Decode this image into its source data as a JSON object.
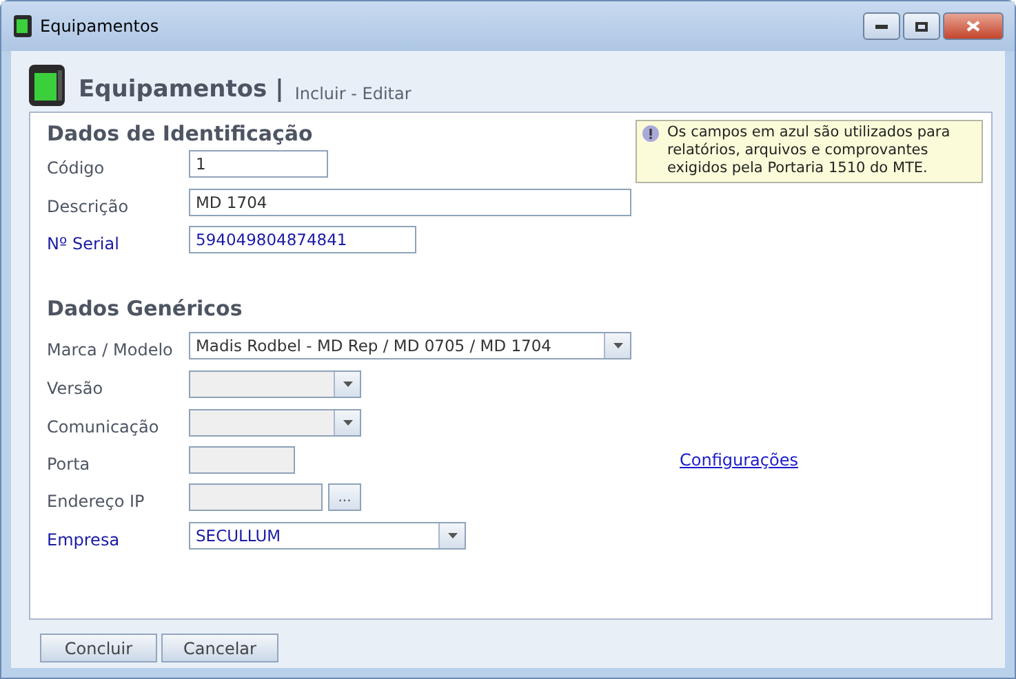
{
  "window": {
    "title": "Equipamentos"
  },
  "header": {
    "title": "Equipamentos",
    "separator": "|",
    "subtitle": "Incluir - Editar"
  },
  "notice": {
    "text": "Os campos em azul são utilizados para relatórios, arquivos e comprovantes exigidos pela Portaria 1510 do MTE."
  },
  "sections": [
    {
      "title": "Dados de Identificação",
      "fields": [
        {
          "label": "Código",
          "kind": "text",
          "value": "1",
          "highlighted": false,
          "disabled": false
        },
        {
          "label": "Descrição",
          "kind": "text",
          "value": "MD 1704",
          "highlighted": false,
          "disabled": false
        },
        {
          "label": "Nº Serial",
          "kind": "text",
          "value": "594049804874841",
          "highlighted": true,
          "disabled": false
        }
      ]
    },
    {
      "title": "Dados Genéricos",
      "fields": [
        {
          "label": "Marca / Modelo",
          "kind": "select",
          "value": "Madis Rodbel - MD Rep / MD 0705 / MD 1704",
          "highlighted": false,
          "disabled": false
        },
        {
          "label": "Versão",
          "kind": "select",
          "highlighted": false,
          "disabled": true
        },
        {
          "label": "Comunicação",
          "kind": "select",
          "highlighted": false,
          "disabled": true
        },
        {
          "label": "Porta",
          "kind": "text",
          "highlighted": false,
          "disabled": true,
          "link": "Configurações"
        },
        {
          "label": "Endereço IP",
          "kind": "browse",
          "button": "...",
          "highlighted": false,
          "disabled": true
        },
        {
          "label": "Empresa",
          "kind": "select",
          "value": "SECULLUM",
          "highlighted": true,
          "disabled": false
        }
      ]
    }
  ],
  "buttons": [
    "Concluir",
    "Cancelar"
  ]
}
